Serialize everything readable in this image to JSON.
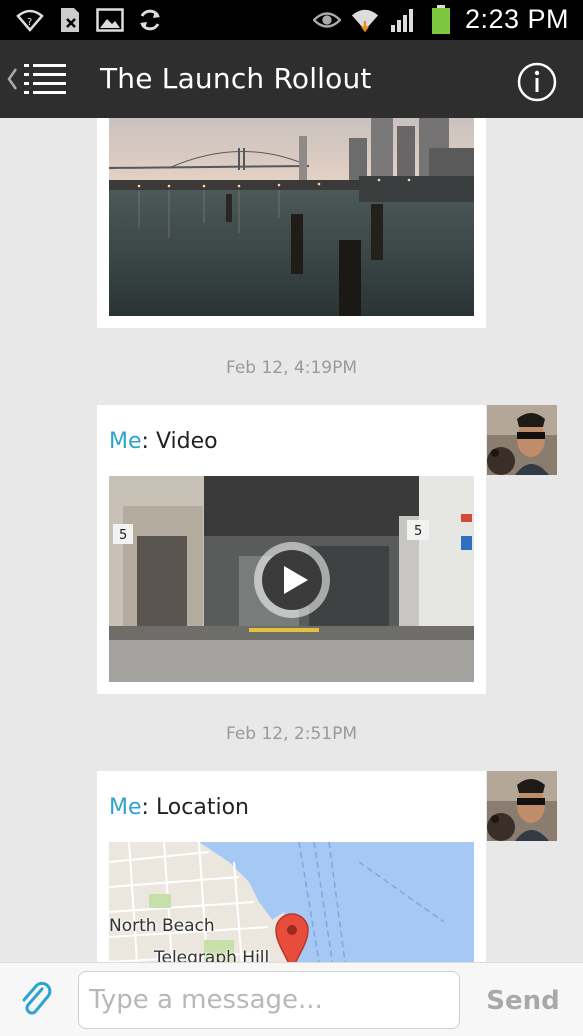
{
  "status_bar": {
    "time": "2:23 PM",
    "battery_color": "#7dc73e"
  },
  "app_bar": {
    "title": "The Launch Rollout"
  },
  "messages": [
    {
      "type": "photo",
      "image_desc": "bay-bridge-pier-photo"
    },
    {
      "timestamp": "Feb 12, 4:19PM",
      "sender": "Me",
      "separator": ": ",
      "kind": "Video"
    },
    {
      "timestamp": "Feb 12, 2:51PM",
      "sender": "Me",
      "separator": ": ",
      "kind": "Location",
      "map_labels": [
        "North Beach",
        "Telegraph Hill"
      ]
    }
  ],
  "composer": {
    "placeholder": "Type a message...",
    "send_label": "Send"
  },
  "colors": {
    "accent": "#2ca3d0",
    "app_bar": "#2e2e2e",
    "background": "#e7e8e7"
  }
}
